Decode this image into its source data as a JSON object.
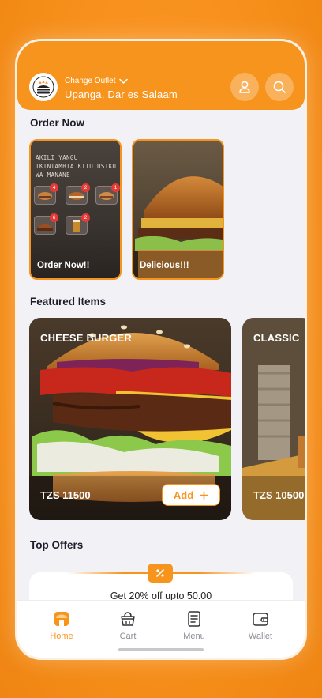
{
  "header": {
    "change_outlet_label": "Change Outlet",
    "outlet_name": "Upanga, Dar es Salaam",
    "accent_color": "#f7941d"
  },
  "order_now": {
    "title": "Order Now",
    "cards": [
      {
        "caption": "Order Now!!",
        "board_text": "AKILI YANGU IKINIAMBIA KITU USIKU WA MANANE",
        "badges": [
          "4",
          "2",
          "1",
          "6",
          "2"
        ]
      },
      {
        "caption": "Delicious!!!"
      }
    ]
  },
  "featured": {
    "title": "Featured Items",
    "items": [
      {
        "name": "CHEESE BURGER",
        "price": "TZS 11500",
        "add_label": "Add"
      },
      {
        "name": "CLASSIC",
        "price": "TZS 10500"
      }
    ]
  },
  "offers": {
    "title": "Top Offers",
    "text": "Get 20% off upto 50.00"
  },
  "nav": {
    "items": [
      {
        "label": "Home",
        "icon": "home-store-icon",
        "active": true
      },
      {
        "label": "Cart",
        "icon": "basket-icon"
      },
      {
        "label": "Menu",
        "icon": "menu-doc-icon"
      },
      {
        "label": "Wallet",
        "icon": "wallet-icon"
      }
    ]
  }
}
